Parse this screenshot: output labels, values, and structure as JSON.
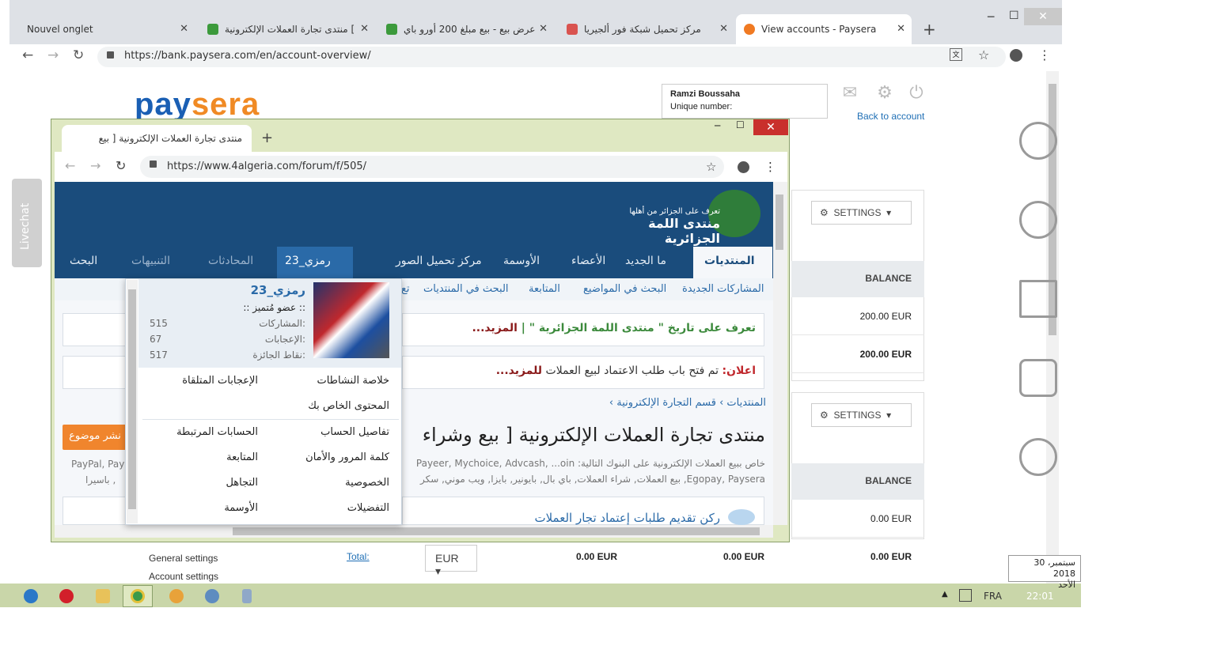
{
  "browser": {
    "tabs": [
      {
        "title": "Nouvel onglet",
        "color": "#dee1e6"
      },
      {
        "title": "منتدى تجارة العملات الإلكترونية [",
        "color": "#3c9a3c"
      },
      {
        "title": "عرض بيع - بيع مبلغ 200 أورو باي",
        "color": "#3c9a3c"
      },
      {
        "title": "مركز تحميل شبكة فور ألجيريا",
        "color": "#d9534f"
      },
      {
        "title": "View accounts - Paysera",
        "color": "#f07a22"
      }
    ],
    "url": "https://bank.paysera.com/en/account-overview/",
    "new_tab": "+"
  },
  "paysera": {
    "logo_a": "pay",
    "logo_b": "sera",
    "user_name": "Ramzi Boussaha",
    "unique_label": "Unique number:",
    "back_link": "Back to account",
    "settings_label": "SETTINGS",
    "balance_header": "BALANCE",
    "balances1": [
      "200.00 EUR",
      "200.00 EUR"
    ],
    "balances2": [
      "0.00 EUR",
      "0.00 EUR"
    ],
    "total_label": "Total:",
    "currency": "EUR",
    "totals": [
      "0.00 EUR",
      "0.00 EUR",
      "0.00 EUR"
    ],
    "side_items": [
      "General settings",
      "Account settings"
    ],
    "livechat": "Livechat"
  },
  "popup": {
    "tab_title": "منتدى تجارة العملات الإلكترونية [ بيع",
    "url": "https://www.4algeria.com/forum/f/505/",
    "logo_title": "منتدى اللمة الجزائرية",
    "logo_sub": "تعرف على الجزائر من أهلها",
    "nav": [
      "المنتديات",
      "ما الجديد",
      "الأعضاء",
      "الأوسمة",
      "مركز تحميل الصور"
    ],
    "user_tab": "رمزي_23",
    "nav_right": [
      "المحادثات",
      "التنبيهات",
      "البحث"
    ],
    "subnav": [
      "المشاركات الجديدة",
      "البحث في المواضيع",
      "المتابعة",
      "البحث في المنتديات",
      "تع"
    ],
    "notice1_a": "تعرف على تاريخ \" منتدى اللمة الجزائرية \" |",
    "notice1_b": " المزيد...",
    "notice2_a": "اعلان:",
    "notice2_b": " تم فتح باب طلب الاعتماد لبيع العملات ",
    "notice2_c": "للمزيد...",
    "crumb": "المنتديات  ›  قسم التجارة الإلكترونية  ›",
    "title": "منتدى تجارة العملات الإلكترونية [ بيع وشراء",
    "desc1": "خاص ببيع العملات الإلكترونية على البنوك التالية: Payeer, Mychoice, Advcash, ...oin",
    "desc2": "Egopay, Paysera, بيع العملات, شراء العملات, باي بال, بايونير, بايزا, ويب موني, سكر",
    "link_row": "ركن تقديم طلبات إعتماد تجار العملات",
    "new_topic": "نشر موضوع",
    "left_desc1": "PayPal, Payo",
    "left_desc2": "باسيرا ,"
  },
  "dropdown": {
    "username": "رمزي_23",
    "rank": ":: عضو مُتميز ::",
    "stats": [
      {
        "label": "المشاركات:",
        "value": "515"
      },
      {
        "label": "الإعجابات:",
        "value": "67"
      },
      {
        "label": "نقاط الجائزة:",
        "value": "517"
      }
    ],
    "links": [
      [
        "خلاصة النشاطات",
        "الإعجابات المتلقاة"
      ],
      [
        "المحتوى الخاص بك",
        ""
      ],
      [
        "تفاصيل الحساب",
        "الحسابات المرتبطة"
      ],
      [
        "كلمة المرور والأمان",
        "المتابعة"
      ],
      [
        "الخصوصية",
        "التجاهل"
      ],
      [
        "التفضيلات",
        "الأوسمة"
      ]
    ]
  },
  "taskbar": {
    "lang": "FRA",
    "time": "22:01",
    "date": "30 سبتمبر، 2018",
    "day": "الأحد"
  }
}
